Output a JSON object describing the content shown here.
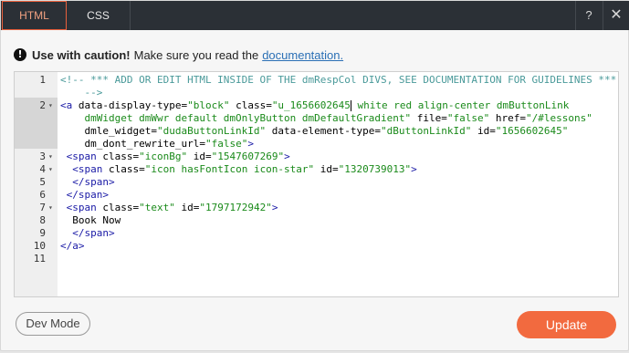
{
  "tabs": [
    {
      "label": "HTML",
      "active": true
    },
    {
      "label": "CSS",
      "active": false
    }
  ],
  "toolbar": {
    "help_glyph": "?",
    "close_glyph": "✕"
  },
  "caution": {
    "bold": "Use with caution!",
    "text": "Make sure you read the",
    "link": "documentation."
  },
  "editor": {
    "lines": [
      {
        "n": "1",
        "fold": "",
        "segs": [
          [
            "comment",
            "<!-- *** ADD OR EDIT HTML INSIDE OF THE dmRespCol DIVS, SEE DOCUMENTATION FOR GUIDELINES ***"
          ]
        ]
      },
      {
        "n": "",
        "fold": "",
        "segs": [
          [
            "comment",
            "    -->"
          ]
        ]
      },
      {
        "n": "2",
        "fold": "▾",
        "segs": [
          [
            "tag",
            "<a "
          ],
          [
            "attr",
            "data-display-type="
          ],
          [
            "str",
            "\"block\""
          ],
          [
            "attr",
            " class="
          ],
          [
            "str",
            "\"u_1656602645"
          ],
          [
            "cursor",
            ""
          ],
          [
            "str",
            " white red align-center dmButtonLink"
          ]
        ]
      },
      {
        "n": "",
        "fold": "",
        "segs": [
          [
            "str",
            "    dmWidget dmWwr default dmOnlyButton dmDefaultGradient\""
          ],
          [
            "attr",
            " file="
          ],
          [
            "str",
            "\"false\""
          ],
          [
            "attr",
            " href="
          ],
          [
            "str",
            "\"/#lessons\""
          ]
        ]
      },
      {
        "n": "",
        "fold": "",
        "segs": [
          [
            "attr",
            "    dmle_widget="
          ],
          [
            "str",
            "\"dudaButtonLinkId\""
          ],
          [
            "attr",
            " data-element-type="
          ],
          [
            "str",
            "\"dButtonLinkId\""
          ],
          [
            "attr",
            " id="
          ],
          [
            "str",
            "\"1656602645\""
          ]
        ]
      },
      {
        "n": "",
        "fold": "",
        "segs": [
          [
            "attr",
            "    dm_dont_rewrite_url="
          ],
          [
            "str",
            "\"false\""
          ],
          [
            "tag",
            ">"
          ]
        ]
      },
      {
        "n": "3",
        "fold": "▾",
        "segs": [
          [
            "tag",
            " <span "
          ],
          [
            "attr",
            "class="
          ],
          [
            "str",
            "\"iconBg\""
          ],
          [
            "attr",
            " id="
          ],
          [
            "str",
            "\"1547607269\""
          ],
          [
            "tag",
            ">"
          ]
        ]
      },
      {
        "n": "4",
        "fold": "▾",
        "segs": [
          [
            "tag",
            "  <span "
          ],
          [
            "attr",
            "class="
          ],
          [
            "str",
            "\"icon hasFontIcon icon-star\""
          ],
          [
            "attr",
            " id="
          ],
          [
            "str",
            "\"1320739013\""
          ],
          [
            "tag",
            ">"
          ]
        ]
      },
      {
        "n": "5",
        "fold": "",
        "segs": [
          [
            "tag",
            "  </span>"
          ]
        ]
      },
      {
        "n": "6",
        "fold": "",
        "segs": [
          [
            "tag",
            " </span>"
          ]
        ]
      },
      {
        "n": "7",
        "fold": "▾",
        "segs": [
          [
            "tag",
            " <span "
          ],
          [
            "attr",
            "class="
          ],
          [
            "str",
            "\"text\""
          ],
          [
            "attr",
            " id="
          ],
          [
            "str",
            "\"1797172942\""
          ],
          [
            "tag",
            ">"
          ]
        ]
      },
      {
        "n": "8",
        "fold": "",
        "segs": [
          [
            "txt",
            "  Book Now"
          ]
        ]
      },
      {
        "n": "9",
        "fold": "",
        "segs": [
          [
            "tag",
            "  </span>"
          ]
        ]
      },
      {
        "n": "10",
        "fold": "",
        "segs": [
          [
            "tag",
            "</a>"
          ]
        ]
      },
      {
        "n": "11",
        "fold": "",
        "segs": []
      }
    ]
  },
  "footer": {
    "dev_mode_label": "Dev Mode",
    "update_label": "Update"
  },
  "colors": {
    "accent": "#f26a3f",
    "tabbar": "#2b3036",
    "link": "#2a6fb5"
  }
}
